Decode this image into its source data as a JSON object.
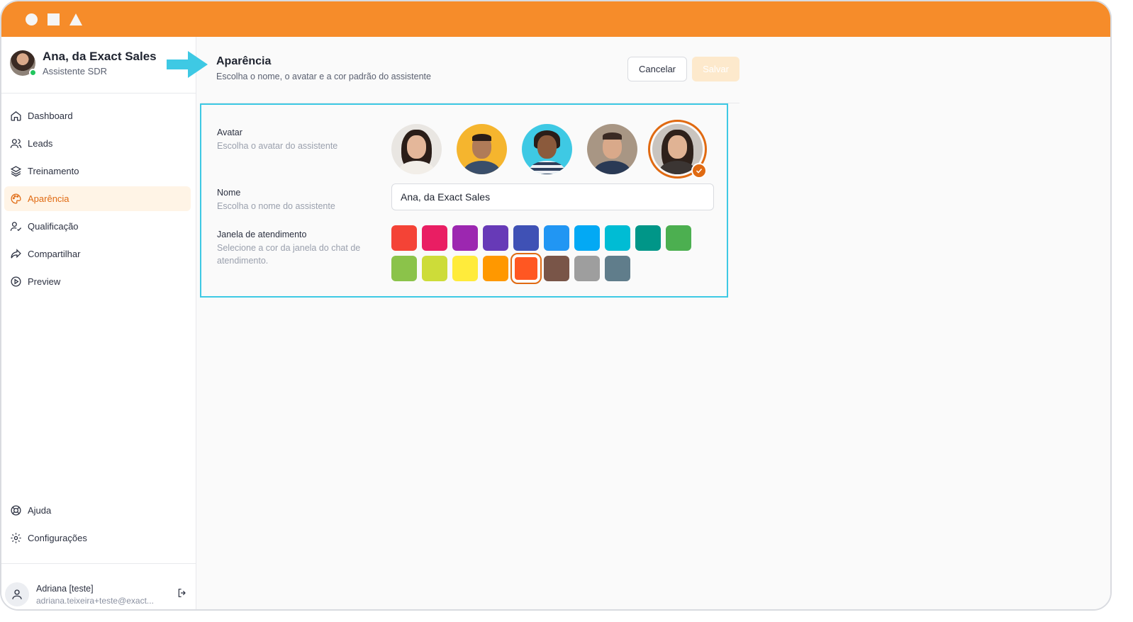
{
  "profile": {
    "name": "Ana, da Exact Sales",
    "role": "Assistente SDR"
  },
  "nav": [
    {
      "label": "Dashboard",
      "icon": "home-icon",
      "active": false
    },
    {
      "label": "Leads",
      "icon": "users-icon",
      "active": false
    },
    {
      "label": "Treinamento",
      "icon": "layers-icon",
      "active": false
    },
    {
      "label": "Aparência",
      "icon": "palette-icon",
      "active": true
    },
    {
      "label": "Qualificação",
      "icon": "user-check-icon",
      "active": false
    },
    {
      "label": "Compartilhar",
      "icon": "share-icon",
      "active": false
    },
    {
      "label": "Preview",
      "icon": "play-circle-icon",
      "active": false
    }
  ],
  "nav_bottom": [
    {
      "label": "Ajuda",
      "icon": "lifebuoy-icon"
    },
    {
      "label": "Configurações",
      "icon": "gear-icon"
    }
  ],
  "user": {
    "name": "Adriana [teste]",
    "email": "adriana.teixeira+teste@exact..."
  },
  "header": {
    "title": "Aparência",
    "subtitle": "Escolha o nome, o avatar e a cor padrão do assistente",
    "cancel_label": "Cancelar",
    "save_label": "Salvar"
  },
  "avatar_field": {
    "label": "Avatar",
    "help": "Escolha o avatar do assistente",
    "selected_index": 4
  },
  "name_field": {
    "label": "Nome",
    "help": "Escolha o nome do assistente",
    "value": "Ana, da Exact Sales"
  },
  "color_field": {
    "label": "Janela de atendimento",
    "help": "Selecione a cor da janela do chat de atendimento.",
    "selected_index": 14,
    "colors": [
      "#f44336",
      "#e91e63",
      "#9c27b0",
      "#673ab7",
      "#3f51b5",
      "#2196f3",
      "#03a9f4",
      "#00bcd4",
      "#009688",
      "#4caf50",
      "#8bc34a",
      "#cddc39",
      "#ffeb3b",
      "#ff9800",
      "#ff5722",
      "#795548",
      "#9e9e9e",
      "#607d8b"
    ]
  },
  "colors": {
    "brand": "#f68c2a",
    "accent": "#e06a12",
    "highlight": "#3ec9e4"
  }
}
